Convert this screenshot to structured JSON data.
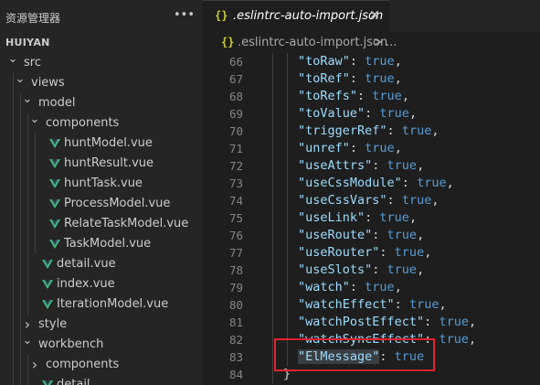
{
  "sidebar": {
    "title": "资源管理器",
    "more_icon": "ellipsis-icon",
    "root": "HUIYAN",
    "tree": [
      {
        "label": "src",
        "type": "folder",
        "open": true,
        "depth": 0
      },
      {
        "label": "views",
        "type": "folder",
        "open": true,
        "depth": 1
      },
      {
        "label": "model",
        "type": "folder",
        "open": true,
        "depth": 2
      },
      {
        "label": "components",
        "type": "folder",
        "open": true,
        "depth": 3
      },
      {
        "label": "huntModel.vue",
        "type": "vue",
        "depth": 4
      },
      {
        "label": "huntResult.vue",
        "type": "vue",
        "depth": 4
      },
      {
        "label": "huntTask.vue",
        "type": "vue",
        "depth": 4
      },
      {
        "label": "ProcessModel.vue",
        "type": "vue",
        "depth": 4
      },
      {
        "label": "RelateTaskModel.vue",
        "type": "vue",
        "depth": 4
      },
      {
        "label": "TaskModel.vue",
        "type": "vue",
        "depth": 4
      },
      {
        "label": "detail.vue",
        "type": "vue",
        "depth": 3
      },
      {
        "label": "index.vue",
        "type": "vue",
        "depth": 3
      },
      {
        "label": "IterationModel.vue",
        "type": "vue",
        "depth": 3
      },
      {
        "label": "style",
        "type": "folder",
        "open": false,
        "depth": 2
      },
      {
        "label": "workbench",
        "type": "folder",
        "open": true,
        "depth": 2
      },
      {
        "label": "components",
        "type": "folder",
        "open": false,
        "depth": 3
      },
      {
        "label": "detail...",
        "type": "vue",
        "depth": 3
      }
    ]
  },
  "editor": {
    "tab": {
      "icon": "{}",
      "label": ".eslintrc-auto-import.json",
      "close_icon": "close-icon"
    },
    "breadcrumb": {
      "icon": "{}",
      "file": ".eslintrc-auto-import.json",
      "separator": ">",
      "more": "..."
    },
    "lines": [
      {
        "n": "66",
        "key": "\"toRaw\"",
        "val": "true",
        "comma": ","
      },
      {
        "n": "67",
        "key": "\"toRef\"",
        "val": "true",
        "comma": ","
      },
      {
        "n": "68",
        "key": "\"toRefs\"",
        "val": "true",
        "comma": ","
      },
      {
        "n": "69",
        "key": "\"toValue\"",
        "val": "true",
        "comma": ","
      },
      {
        "n": "70",
        "key": "\"triggerRef\"",
        "val": "true",
        "comma": ","
      },
      {
        "n": "71",
        "key": "\"unref\"",
        "val": "true",
        "comma": ","
      },
      {
        "n": "72",
        "key": "\"useAttrs\"",
        "val": "true",
        "comma": ","
      },
      {
        "n": "73",
        "key": "\"useCssModule\"",
        "val": "true",
        "comma": ","
      },
      {
        "n": "74",
        "key": "\"useCssVars\"",
        "val": "true",
        "comma": ","
      },
      {
        "n": "75",
        "key": "\"useLink\"",
        "val": "true",
        "comma": ","
      },
      {
        "n": "76",
        "key": "\"useRoute\"",
        "val": "true",
        "comma": ","
      },
      {
        "n": "77",
        "key": "\"useRouter\"",
        "val": "true",
        "comma": ","
      },
      {
        "n": "78",
        "key": "\"useSlots\"",
        "val": "true",
        "comma": ","
      },
      {
        "n": "79",
        "key": "\"watch\"",
        "val": "true",
        "comma": ","
      },
      {
        "n": "80",
        "key": "\"watchEffect\"",
        "val": "true",
        "comma": ","
      },
      {
        "n": "81",
        "key": "\"watchPostEffect\"",
        "val": "true",
        "comma": ","
      },
      {
        "n": "82",
        "key": "\"watchSyncEffect\"",
        "val": "true",
        "comma": ","
      },
      {
        "n": "83",
        "key": "\"ElMessage\"",
        "val": "true",
        "comma": "",
        "highlighted": true
      },
      {
        "n": "84",
        "close": "}"
      }
    ]
  },
  "colors": {
    "vue_icon": "#41b883",
    "json_icon": "#cbcb41",
    "json_key": "#9cdcfe",
    "json_bool": "#569cd6",
    "highlight_box": "#e5232e"
  }
}
